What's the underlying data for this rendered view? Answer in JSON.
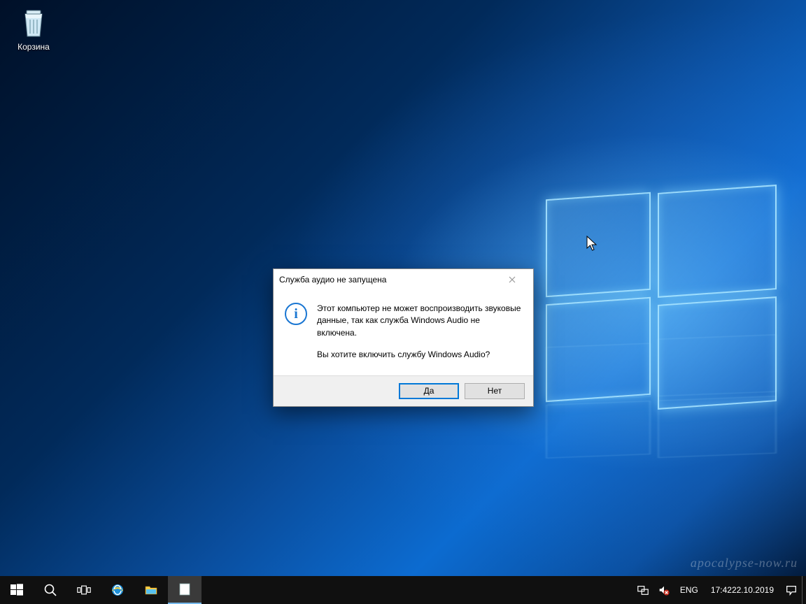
{
  "desktop": {
    "recycle_bin_label": "Корзина"
  },
  "dialog": {
    "title": "Служба аудио не запущена",
    "line1": "Этот компьютер не может воспроизводить звуковые данные, так как служба Windows Audio не включена.",
    "line2": "Вы хотите включить службу Windows Audio?",
    "yes": "Да",
    "no": "Нет"
  },
  "taskbar": {
    "language": "ENG",
    "time": "17:42",
    "date": "22.10.2019"
  },
  "watermark": "apocalypse-now.ru"
}
